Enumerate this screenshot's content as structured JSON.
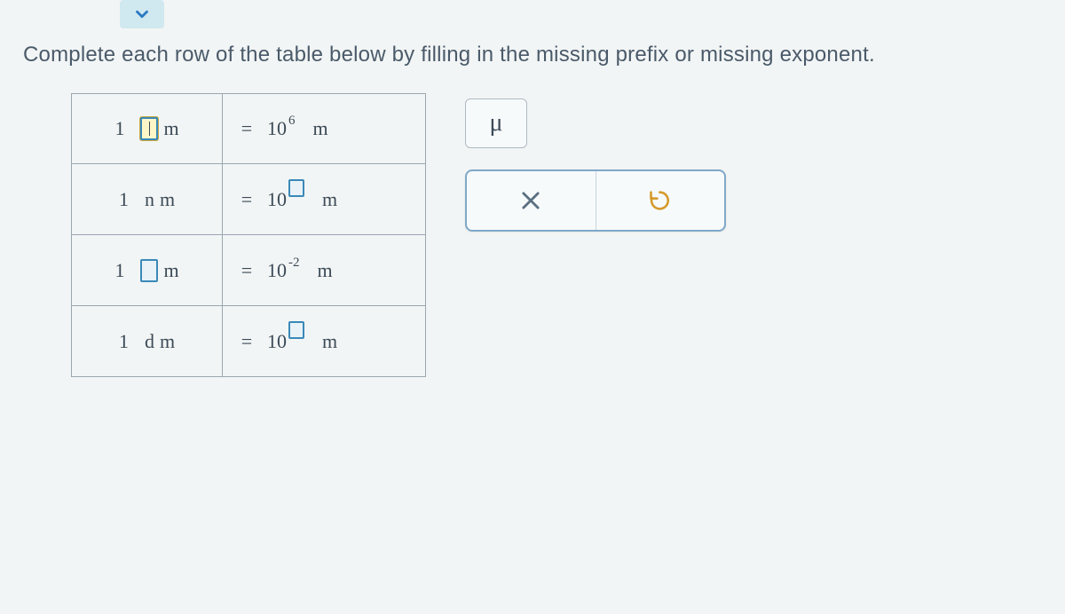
{
  "instruction": "Complete each row of the table below by filling in the missing prefix or missing exponent.",
  "rows": [
    {
      "one": "1",
      "prefix_known": false,
      "prefix": "",
      "unit": "m",
      "base": "10",
      "exp_known": true,
      "exp": "6",
      "unit_r": "m",
      "active": true
    },
    {
      "one": "1",
      "prefix_known": true,
      "prefix": "n",
      "unit": "m",
      "base": "10",
      "exp_known": false,
      "exp": "",
      "unit_r": "m",
      "active": false
    },
    {
      "one": "1",
      "prefix_known": false,
      "prefix": "",
      "unit": "m",
      "base": "10",
      "exp_known": true,
      "exp": "-2",
      "unit_r": "m",
      "active": false
    },
    {
      "one": "1",
      "prefix_known": true,
      "prefix": "d",
      "unit": "m",
      "base": "10",
      "exp_known": false,
      "exp": "",
      "unit_r": "m",
      "active": false
    }
  ],
  "equals": "=",
  "mu_label": "μ"
}
